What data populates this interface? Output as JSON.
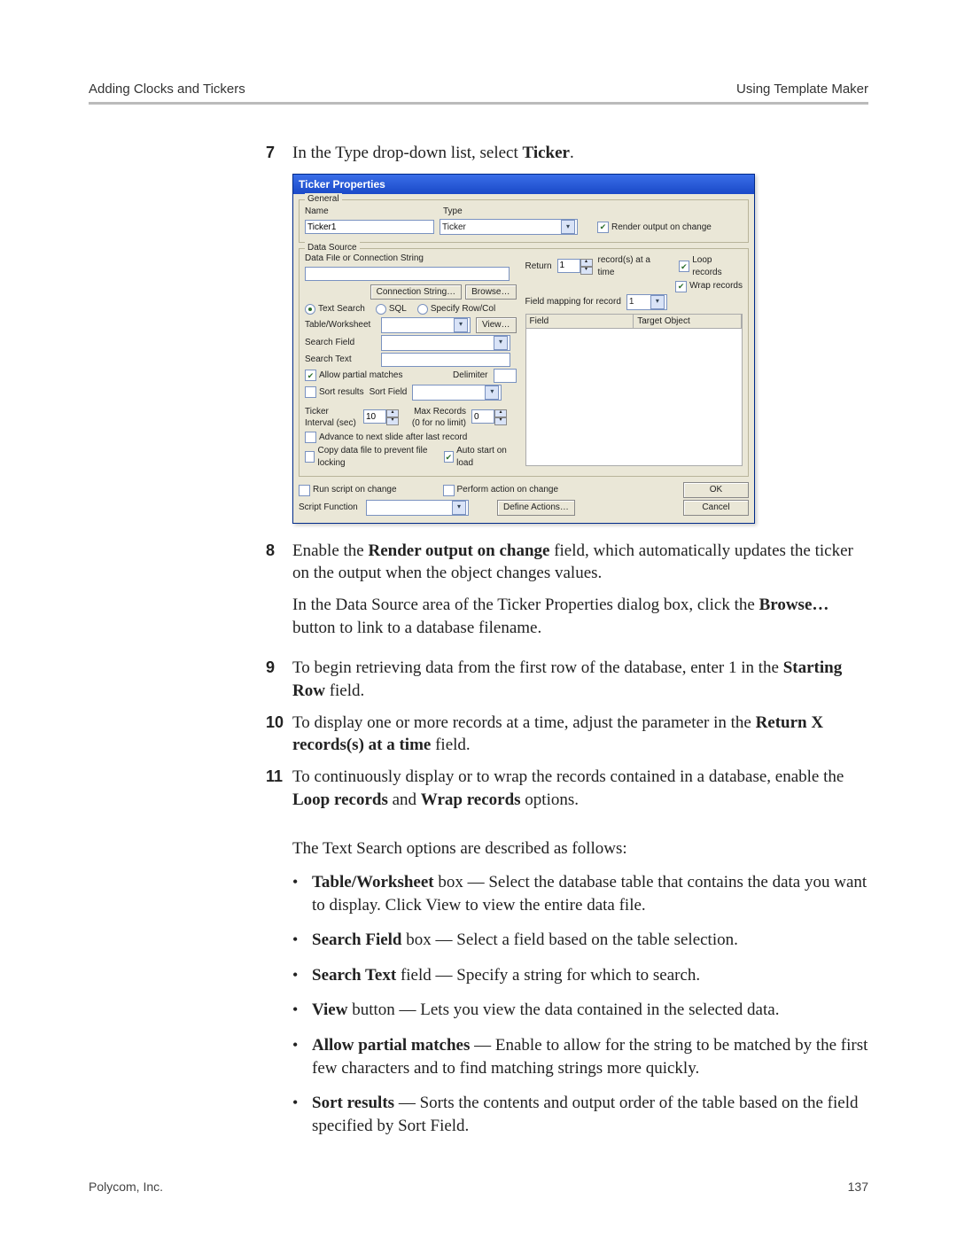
{
  "header": {
    "left": "Adding Clocks and Tickers",
    "right": "Using Template Maker"
  },
  "footer": {
    "left": "Polycom, Inc.",
    "right": "137"
  },
  "steps": {
    "s7": {
      "num": "7",
      "text_a": "In the Type drop-down list, select ",
      "text_b": "Ticker",
      "text_c": "."
    },
    "s8": {
      "num": "8",
      "p1_a": "Enable the ",
      "p1_b": "Render output on change",
      "p1_c": " field, which automatically updates the ticker on the output when the object changes values.",
      "p2_a": "In the Data Source area of the Ticker Properties dialog box, click the ",
      "p2_b": "Browse…",
      "p2_c": " button to link to a database filename."
    },
    "s9": {
      "num": "9",
      "a": "To begin retrieving data from the first row of the database, enter 1 in the ",
      "b": "Starting Row",
      "c": " field."
    },
    "s10": {
      "num": "10",
      "a": "To display one or more records at a time, adjust the parameter in the ",
      "b": "Return X records(s) at a time",
      "c": " field."
    },
    "s11": {
      "num": "11",
      "a": "To continuously display or to wrap the records contained in a database, enable the ",
      "b": "Loop records",
      "c": " and ",
      "d": "Wrap records",
      "e": " options."
    }
  },
  "intro": "The Text Search options are described as follows:",
  "bullets": {
    "b1": {
      "a": "Table/Worksheet",
      "b": " box — Select the database table that contains the data you want to display. Click View to view the entire data file."
    },
    "b2": {
      "a": "Search Field",
      "b": " box — Select a field based on the table selection."
    },
    "b3": {
      "a": "Search Text",
      "b": " field — Specify a string for which to search."
    },
    "b4": {
      "a": "View",
      "b": " button — Lets you view the data contained in the selected data."
    },
    "b5": {
      "a": "Allow partial matches",
      "b": " — Enable to allow for the string to be matched by the first few characters and to find matching strings more quickly."
    },
    "b6": {
      "a": "Sort results",
      "b": " — Sorts the contents and output order of the table based on the field specified by Sort Field."
    }
  },
  "dlg": {
    "title": "Ticker Properties",
    "general": {
      "legend": "General",
      "name_lbl": "Name",
      "name_val": "Ticker1",
      "type_lbl": "Type",
      "type_val": "Ticker",
      "render_lbl": "Render output on change"
    },
    "ds": {
      "legend": "Data Source",
      "file_lbl": "Data File or Connection String",
      "conn_btn": "Connection String…",
      "browse_btn": "Browse…",
      "r_text": "Text Search",
      "r_sql": "SQL",
      "r_spec": "Specify Row/Col",
      "tw_lbl": "Table/Worksheet",
      "view_btn": "View…",
      "sf_lbl": "Search Field",
      "st_lbl": "Search Text",
      "apm_lbl": "Allow partial matches",
      "delim_lbl": "Delimiter",
      "sort_lbl": "Sort results",
      "sortf_lbl": "Sort Field",
      "ti_lbl": "Ticker Interval (sec)",
      "ti_val": "10",
      "mr_lbl": "Max Records (0 for no limit)",
      "mr_val": "0",
      "adv_lbl": "Advance to next slide after last record",
      "copy_lbl": "Copy data file to prevent file locking",
      "auto_lbl": "Auto start on load",
      "return_lbl": "Return",
      "return_val": "1",
      "return_suffix": "record(s) at a time",
      "loop_lbl": "Loop records",
      "wrap_lbl": "Wrap records",
      "fmap_lbl": "Field mapping for record",
      "fmap_val": "1",
      "col_field": "Field",
      "col_target": "Target Object"
    },
    "bottom": {
      "run_lbl": "Run script on change",
      "perf_lbl": "Perform action on change",
      "sf_lbl": "Script Function",
      "da_btn": "Define Actions…",
      "ok": "OK",
      "cancel": "Cancel"
    }
  }
}
